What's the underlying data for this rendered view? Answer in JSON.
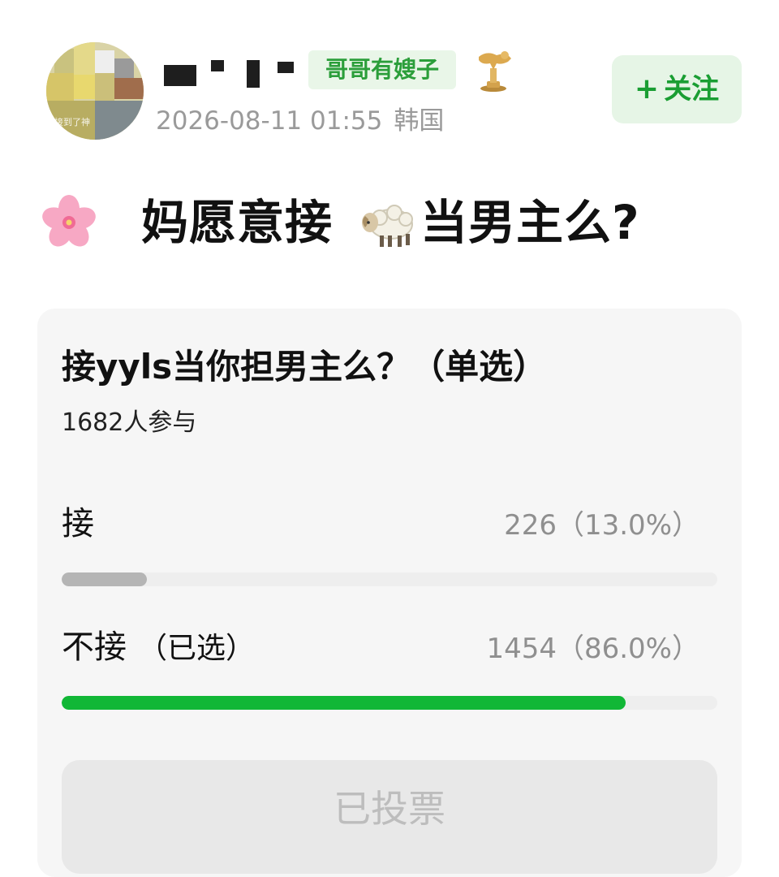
{
  "post": {
    "avatar_caption": "接到了神",
    "user_tag": "哥哥有嫂子",
    "timestamp": "2026-08-11 01:55",
    "location": "韩国",
    "follow_label": "关注",
    "title_part1": "妈愿意接",
    "title_part2": "当男主么?",
    "title_icons": [
      "cherry-blossom-icon",
      "sheep-icon"
    ]
  },
  "poll": {
    "question": "接yyls当你担男主么？（单选）",
    "participants": "1682人参与",
    "options": [
      {
        "label": "接",
        "selected_note": "",
        "value_text": "226（13.0%）",
        "share": 0.13,
        "bar_color": "#b5b5b5"
      },
      {
        "label": "不接",
        "selected_note": "（已选）",
        "value_text": "1454（86.0%）",
        "share": 0.86,
        "bar_color": "#11b736"
      }
    ],
    "button_label": "已投票"
  },
  "colors": {
    "accent_green": "#1a9e33",
    "tag_green": "#2b9e3a",
    "meta_gray": "#9a9a9a"
  }
}
